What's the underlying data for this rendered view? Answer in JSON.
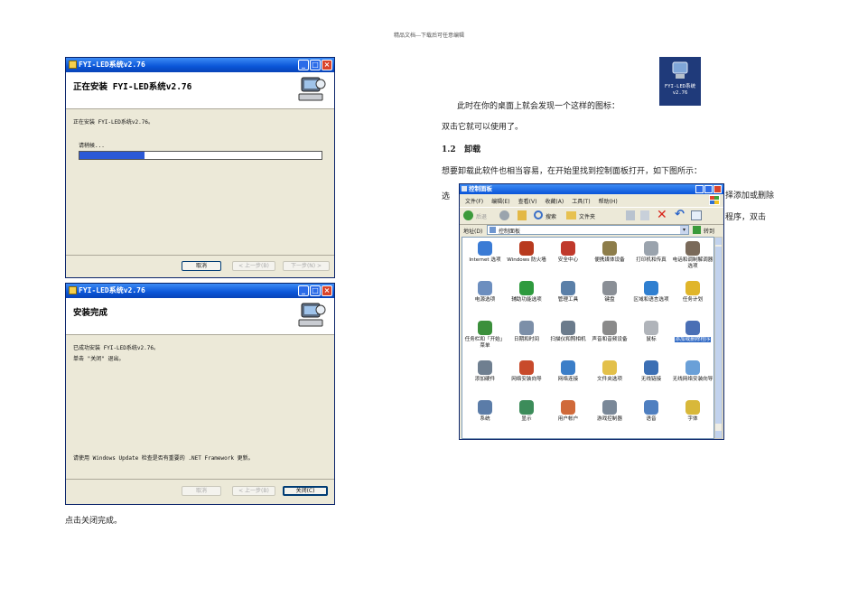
{
  "header_note": "精品文档---下载后可任意编辑",
  "install_window": {
    "title": "FYI-LED系统v2.76",
    "banner_title": "正在安装 FYI-LED系统v2.76",
    "status_line": "正在安装 FYI-LED系统v2.76。",
    "wait_label": "请稍候...",
    "progress_fraction": 0.27,
    "buttons": {
      "cancel": "取消",
      "back": "< 上一步(B)",
      "next": "下一步(N) >"
    }
  },
  "complete_window": {
    "title": "FYI-LED系统v2.76",
    "banner_title": "安装完成",
    "line1": "已成功安装 FYI-LED系统v2.76。",
    "line2": "单击 \"关闭\" 退出。",
    "update_note": "请使用 Windows Update 检查是否有重要的 .NET Framework 更新。",
    "buttons": {
      "cancel": "取消",
      "back": "< 上一步(B)",
      "close": "关闭(C)"
    }
  },
  "caption_click_close": "点击关闭完成。",
  "desktop_icon_text": "此时在你的桌面上就会发现一个这样的图标：",
  "desktop_icon_label": "FYI-LED系统 v2.76",
  "double_click_text": "双击它就可以使用了。",
  "section_number": "1.2",
  "section_title": "卸载",
  "uninstall_text": "想要卸载此软件也相当容易，在开始里找到控制面板打开，如下图所示：",
  "select_prefix": "选",
  "select_suffix_1": "择添加或删除",
  "select_suffix_2": "程序，双击",
  "control_panel": {
    "title": "控制面板",
    "menu": [
      "文件(F)",
      "编辑(E)",
      "查看(V)",
      "收藏(A)",
      "工具(T)",
      "帮助(H)"
    ],
    "toolbar": {
      "back": "后退",
      "search": "搜索",
      "folders": "文件夹"
    },
    "address_label": "地址(D)",
    "address_value": "控制面板",
    "go_label": "转到",
    "items": [
      {
        "label": "Internet 选项",
        "color": "#3a7bd5"
      },
      {
        "label": "Windows 防火墙",
        "color": "#b83a1e"
      },
      {
        "label": "安全中心",
        "color": "#c0392b"
      },
      {
        "label": "便携媒体设备",
        "color": "#8d7d4a"
      },
      {
        "label": "打印机和传真",
        "color": "#9aa3ad"
      },
      {
        "label": "电话和调制解调器选项",
        "color": "#7a6a5a"
      },
      {
        "label": "电源选项",
        "color": "#6c8ebf"
      },
      {
        "label": "辅助功能选项",
        "color": "#2e9a3e"
      },
      {
        "label": "管理工具",
        "color": "#5a7fa8"
      },
      {
        "label": "键盘",
        "color": "#8a8f96"
      },
      {
        "label": "区域和语言选项",
        "color": "#2f7fd0"
      },
      {
        "label": "任务计划",
        "color": "#e0b52a"
      },
      {
        "label": "任务栏和「开始」菜单",
        "color": "#3b8f3b"
      },
      {
        "label": "日期和时间",
        "color": "#7c8fa8"
      },
      {
        "label": "扫描仪和照相机",
        "color": "#6b7b8c"
      },
      {
        "label": "声音和音频设备",
        "color": "#8a8a8a"
      },
      {
        "label": "鼠标",
        "color": "#b0b4ba"
      },
      {
        "label": "添加或删除程序",
        "color": "#4a6fb5"
      },
      {
        "label": "添加硬件",
        "color": "#6f7f90"
      },
      {
        "label": "网络安装向导",
        "color": "#c84a2b"
      },
      {
        "label": "网络连接",
        "color": "#3b7ec8"
      },
      {
        "label": "文件夹选项",
        "color": "#e3c04a"
      },
      {
        "label": "无线链接",
        "color": "#3c6fb4"
      },
      {
        "label": "无线网络安装向导",
        "color": "#6aa0d8"
      },
      {
        "label": "系统",
        "color": "#5b7ca8"
      },
      {
        "label": "显示",
        "color": "#3c8c5a"
      },
      {
        "label": "用户帐户",
        "color": "#d06a3a"
      },
      {
        "label": "游戏控制器",
        "color": "#7a8898"
      },
      {
        "label": "语音",
        "color": "#4f7fc0"
      },
      {
        "label": "字体",
        "color": "#d8b83a"
      }
    ],
    "selected_item": "添加或删除程序"
  }
}
